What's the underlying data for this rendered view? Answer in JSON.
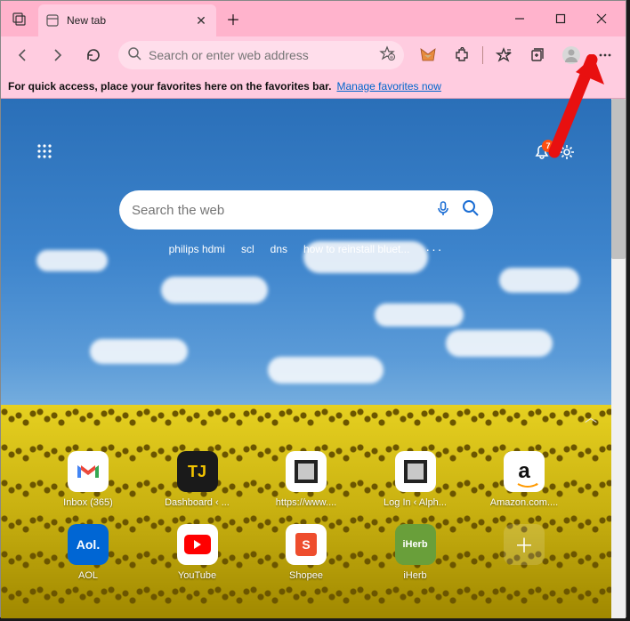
{
  "tab": {
    "title": "New tab"
  },
  "addressbar": {
    "placeholder": "Search or enter web address"
  },
  "favbar": {
    "text": "For quick access, place your favorites here on the favorites bar.",
    "link": "Manage favorites now"
  },
  "notifications": {
    "count": "7"
  },
  "searchbox": {
    "placeholder": "Search the web"
  },
  "suggestions": {
    "items": [
      "philips hdmi",
      "scl",
      "dns",
      "how to reinstall bluet..."
    ],
    "more": "···"
  },
  "quicklinks": {
    "row1": [
      {
        "label": "Inbox (365)",
        "icon": "gmail"
      },
      {
        "label": "Dashboard ‹ ...",
        "icon": "tj",
        "text": "TJ"
      },
      {
        "label": "https://www....",
        "icon": "box"
      },
      {
        "label": "Log In ‹ Alph...",
        "icon": "box"
      },
      {
        "label": "Amazon.com....",
        "icon": "amazon",
        "text": "a"
      }
    ],
    "row2": [
      {
        "label": "AOL",
        "icon": "aol",
        "text": "Aol."
      },
      {
        "label": "YouTube",
        "icon": "youtube"
      },
      {
        "label": "Shopee",
        "icon": "shopee",
        "text": "S"
      },
      {
        "label": "iHerb",
        "icon": "iherb",
        "text": "iHerb"
      }
    ]
  }
}
